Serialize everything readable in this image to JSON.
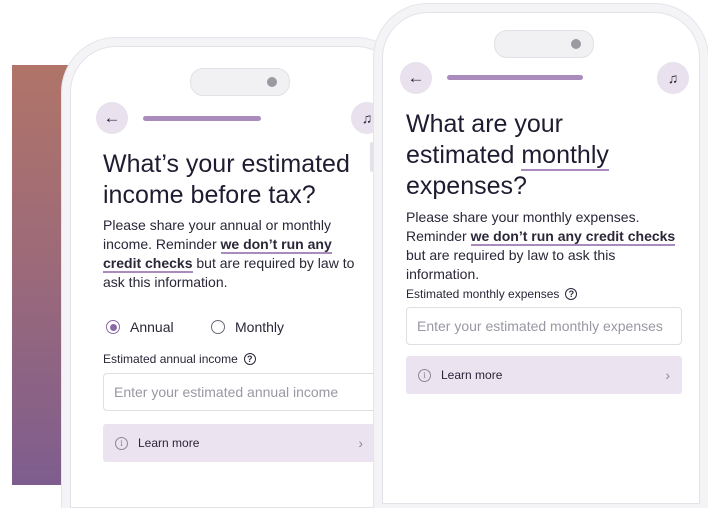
{
  "left_screen": {
    "back_icon": "←",
    "support_icon": "♫",
    "title": "What’s your estimated income before tax?",
    "body_start": "Please share your annual or monthly income. Reminder ",
    "body_emphasis": "we don’t run any credit checks",
    "body_end": " but are required by law to ask this information.",
    "option_annual": "Annual",
    "option_monthly": "Monthly",
    "selected_option": "Annual",
    "field_label": "Estimated annual income",
    "help_icon": "?",
    "input_placeholder": "Enter your estimated annual income",
    "learn_more": "Learn more",
    "info_icon": "i",
    "chevron": "›"
  },
  "right_screen": {
    "back_icon": "←",
    "support_icon": "♫",
    "title_line1": "What are your",
    "title_pre": "estimated ",
    "title_highlight": "monthly",
    "title_line3": "expenses?",
    "body_start": "Please share your monthly expenses. Reminder ",
    "body_emphasis": "we don’t run any credit checks",
    "body_end": " but are required by law to ask this information.",
    "field_label": "Estimated monthly expenses",
    "help_icon": "?",
    "input_placeholder": "Enter your estimated monthly expenses",
    "learn_more": "Learn more",
    "info_icon": "i",
    "chevron": "›"
  },
  "colors": {
    "accent": "#a98cbd",
    "learn_bg": "#ebe3ef",
    "back_bg": "#e9e1ee",
    "gradient_top": "#b07468",
    "gradient_bottom": "#7e5d8e"
  }
}
